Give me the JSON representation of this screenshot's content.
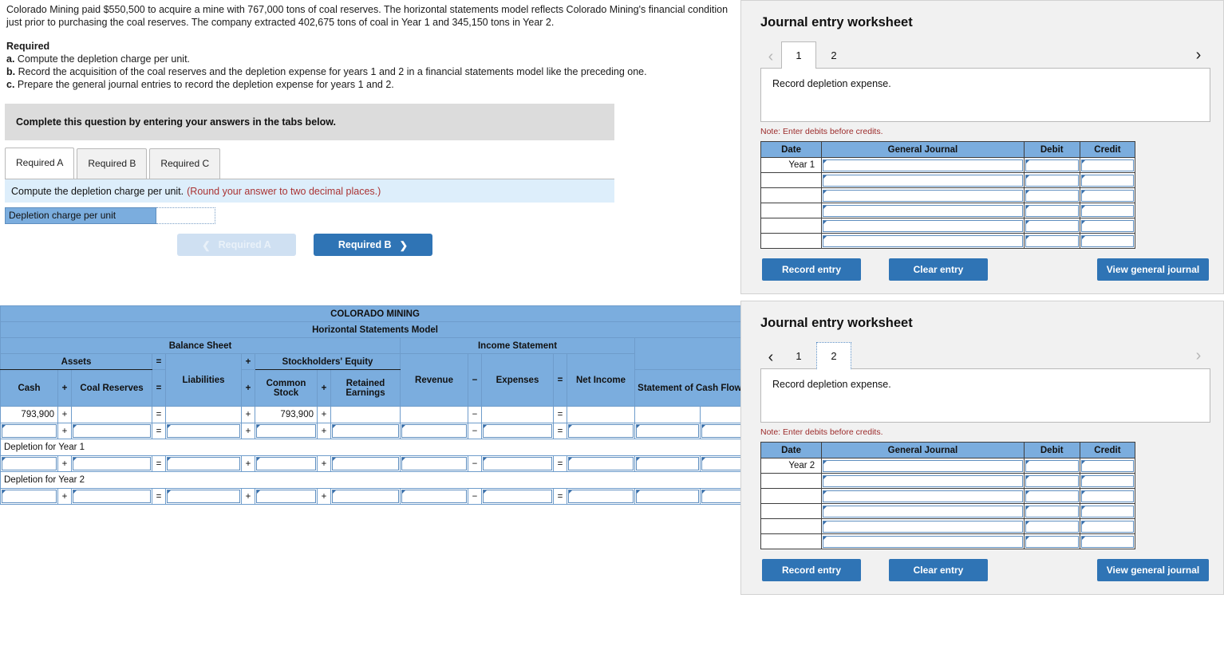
{
  "problem": {
    "paragraph": "Colorado Mining paid $550,500 to acquire a mine with 767,000 tons of coal reserves. The horizontal statements model reflects Colorado Mining's financial condition just prior to purchasing the coal reserves. The company extracted 402,675 tons of coal in Year 1 and 345,150 tons in Year 2.",
    "required_heading": "Required",
    "items": [
      {
        "marker": "a.",
        "text": "Compute the depletion charge per unit."
      },
      {
        "marker": "b.",
        "text": "Record the acquisition of the coal reserves and the depletion expense for years 1 and 2 in a financial statements model like the preceding one."
      },
      {
        "marker": "c.",
        "text": "Prepare the general journal entries to record the depletion expense for years 1 and 2."
      }
    ]
  },
  "complete_bar": "Complete this question by entering your answers in the tabs below.",
  "tabs": [
    {
      "label": "Required A",
      "active": true
    },
    {
      "label": "Required B",
      "active": false
    },
    {
      "label": "Required C",
      "active": false
    }
  ],
  "question_line": {
    "text": "Compute the depletion charge per unit.",
    "hint": "(Round your answer to two decimal places.)"
  },
  "answer_row": {
    "label": "Depletion charge per unit",
    "value": ""
  },
  "nav_buttons": {
    "prev": {
      "label": "Required A",
      "icon": "chevron-left",
      "disabled": true
    },
    "next": {
      "label": "Required B",
      "icon": "chevron-right",
      "disabled": false
    }
  },
  "hsm": {
    "company": "COLORADO MINING",
    "subtitle": "Horizontal Statements Model",
    "group_balance_sheet": "Balance Sheet",
    "group_income_statement": "Income Statement",
    "group_assets": "Assets",
    "group_stockholders_equity": "Stockholders' Equity",
    "col_cash": "Cash",
    "col_coal_reserves": "Coal Reserves",
    "col_liabilities": "Liabilities",
    "col_common_stock": "Common Stock",
    "col_retained_earnings": "Retained Earnings",
    "col_revenue": "Revenue",
    "col_expenses": "Expenses",
    "col_net_income": "Net Income",
    "col_cash_flows": "Statement of Cash Flows",
    "op_plus": "+",
    "op_equals": "=",
    "op_minus": "−",
    "row1": {
      "cash": "793,900",
      "coal_reserves": "",
      "liabilities": "",
      "common_stock": "793,900",
      "retained_earnings": "",
      "revenue": "",
      "expenses": "",
      "net_income": "",
      "cash_flow": "",
      "cash_flow_note": ""
    },
    "section_year1": "Depletion for Year 1",
    "section_year2": "Depletion for Year 2"
  },
  "journal_panels": [
    {
      "title": "Journal entry worksheet",
      "prev_arrow": "‹",
      "next_arrow": "›",
      "prev_disabled": true,
      "next_disabled": false,
      "tabs": [
        {
          "label": "1",
          "active": true
        },
        {
          "label": "2",
          "active": false
        }
      ],
      "body_text": "Record depletion expense.",
      "note": "Note: Enter debits before credits.",
      "table": {
        "headers": [
          "Date",
          "General Journal",
          "Debit",
          "Credit"
        ],
        "rows": [
          {
            "date": "Year 1",
            "general_journal": "",
            "debit": "",
            "credit": ""
          },
          {
            "date": "",
            "general_journal": "",
            "debit": "",
            "credit": ""
          },
          {
            "date": "",
            "general_journal": "",
            "debit": "",
            "credit": ""
          },
          {
            "date": "",
            "general_journal": "",
            "debit": "",
            "credit": ""
          },
          {
            "date": "",
            "general_journal": "",
            "debit": "",
            "credit": ""
          },
          {
            "date": "",
            "general_journal": "",
            "debit": "",
            "credit": ""
          }
        ]
      },
      "buttons": {
        "record": "Record entry",
        "clear": "Clear entry",
        "view": "View general journal"
      }
    },
    {
      "title": "Journal entry worksheet",
      "prev_arrow": "‹",
      "next_arrow": "›",
      "prev_disabled": false,
      "next_disabled": true,
      "tabs": [
        {
          "label": "1",
          "active": false
        },
        {
          "label": "2",
          "active": true
        }
      ],
      "body_text": "Record depletion expense.",
      "note": "Note: Enter debits before credits.",
      "table": {
        "headers": [
          "Date",
          "General Journal",
          "Debit",
          "Credit"
        ],
        "rows": [
          {
            "date": "Year 2",
            "general_journal": "",
            "debit": "",
            "credit": ""
          },
          {
            "date": "",
            "general_journal": "",
            "debit": "",
            "credit": ""
          },
          {
            "date": "",
            "general_journal": "",
            "debit": "",
            "credit": ""
          },
          {
            "date": "",
            "general_journal": "",
            "debit": "",
            "credit": ""
          },
          {
            "date": "",
            "general_journal": "",
            "debit": "",
            "credit": ""
          },
          {
            "date": "",
            "general_journal": "",
            "debit": "",
            "credit": ""
          }
        ]
      },
      "buttons": {
        "record": "Record entry",
        "clear": "Clear entry",
        "view": "View general journal"
      }
    }
  ],
  "colors": {
    "header_blue": "#7badde",
    "button_blue": "#2f74b5",
    "hint_red": "#a33333",
    "note_red": "#9c2b2b",
    "complete_bar_gray": "#dcdcdc",
    "question_bar_blue": "#ddeefb"
  }
}
